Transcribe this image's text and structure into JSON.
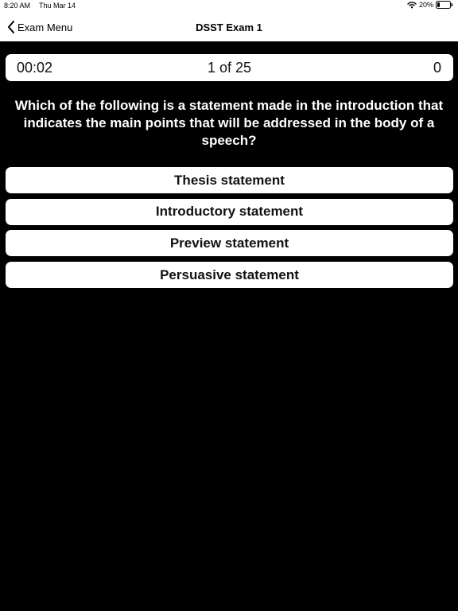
{
  "status_bar": {
    "time": "8:20 AM",
    "date": "Thu Mar 14",
    "battery_percent": "20%",
    "battery_level": 0.2,
    "icons": [
      "wifi-icon",
      "battery-icon"
    ]
  },
  "nav": {
    "back_label": "Exam Menu",
    "title": "DSST Exam 1"
  },
  "info_bar": {
    "timer": "00:02",
    "progress": "1 of 25",
    "score": "0"
  },
  "question": {
    "text": "Which of the following is a statement made in the introduction that indicates the main points that will be addressed in the body of a speech?"
  },
  "answers": [
    {
      "label": "Thesis statement"
    },
    {
      "label": "Introductory statement"
    },
    {
      "label": "Preview statement"
    },
    {
      "label": "Persuasive statement"
    }
  ],
  "colors": {
    "background": "#000000",
    "surface": "#ffffff",
    "text_dark": "#111111",
    "text_light": "#ffffff"
  }
}
